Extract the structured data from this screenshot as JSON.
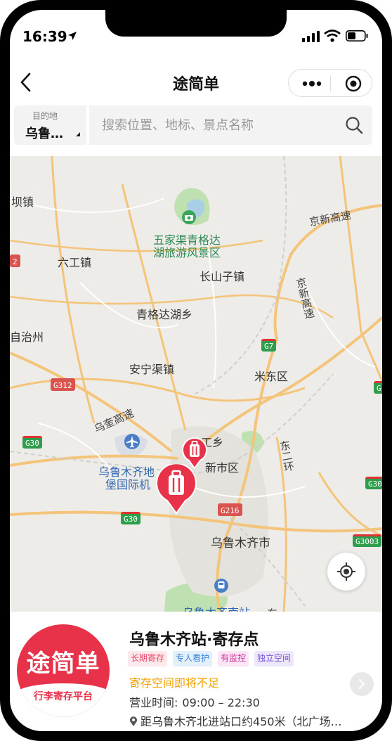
{
  "status_bar": {
    "time": "16:39"
  },
  "nav": {
    "title": "途简单"
  },
  "search": {
    "destination_label": "目的地",
    "destination_value": "乌鲁…",
    "placeholder": "搜索位置、地标、景点名称"
  },
  "map": {
    "labels": {
      "bajizhen": "坝镇",
      "wujiaqu": "五家渠青格达",
      "wujiaqu2": "湖旅游风景区",
      "liugong": "六工镇",
      "changshanzi": "长山子镇",
      "qinggeda": "青格达湖乡",
      "zizhizhou": "自治州",
      "anning": "安宁渠镇",
      "midong": "米东区",
      "sangong": "三工乡",
      "xinshi": "新市区",
      "airport1": "乌鲁木齐地",
      "airport2": "堡国际机",
      "urumqi": "乌鲁木齐市",
      "south_station": "乌鲁木齐南站",
      "jingxin": "京新高速",
      "jingxin_v": "京新高速",
      "wukui": "乌奎高速",
      "dongerhuan": "东二环",
      "dong": "东"
    },
    "shields": {
      "g7": "G7",
      "g312": "G312",
      "g30a": "G30",
      "g30b": "G30",
      "g30c": "G30",
      "g216": "G216",
      "g3003": "G3003",
      "g_right": "G",
      "g_left": "2"
    }
  },
  "card": {
    "logo_title": "途简单",
    "logo_subtitle": "行李寄存平台",
    "name": "乌鲁木齐站·寄存点",
    "tags": [
      "长期寄存",
      "专人看护",
      "有监控",
      "独立空间"
    ],
    "notice": "寄存空间即将不足",
    "hours_label": "营业时间:",
    "hours": "09:00 – 22:30",
    "distance": "距乌鲁木齐北进站口约450米（北广场…"
  },
  "colors": {
    "brand": "#e8324a",
    "notice": "#f0a000",
    "map_bg": "#eeece8",
    "road": "#f3c47a"
  }
}
